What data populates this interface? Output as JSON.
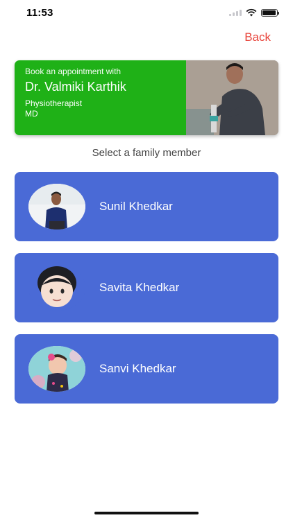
{
  "status_bar": {
    "time": "11:53",
    "icons": [
      "signal-icon",
      "wifi-icon",
      "battery-icon"
    ]
  },
  "nav": {
    "back_label": "Back"
  },
  "doctor": {
    "intro": "Book an appointment with",
    "name": "Dr. Valmiki Karthik",
    "specialty": "Physiotherapist",
    "degree": "MD"
  },
  "select_label": "Select a family member",
  "members": [
    {
      "name": "Sunil Khedkar"
    },
    {
      "name": "Savita Khedkar"
    },
    {
      "name": "Sanvi Khedkar"
    }
  ],
  "colors": {
    "accent_red": "#e8453c",
    "doctor_green": "#1fb117",
    "member_blue": "#4a6ad6"
  }
}
